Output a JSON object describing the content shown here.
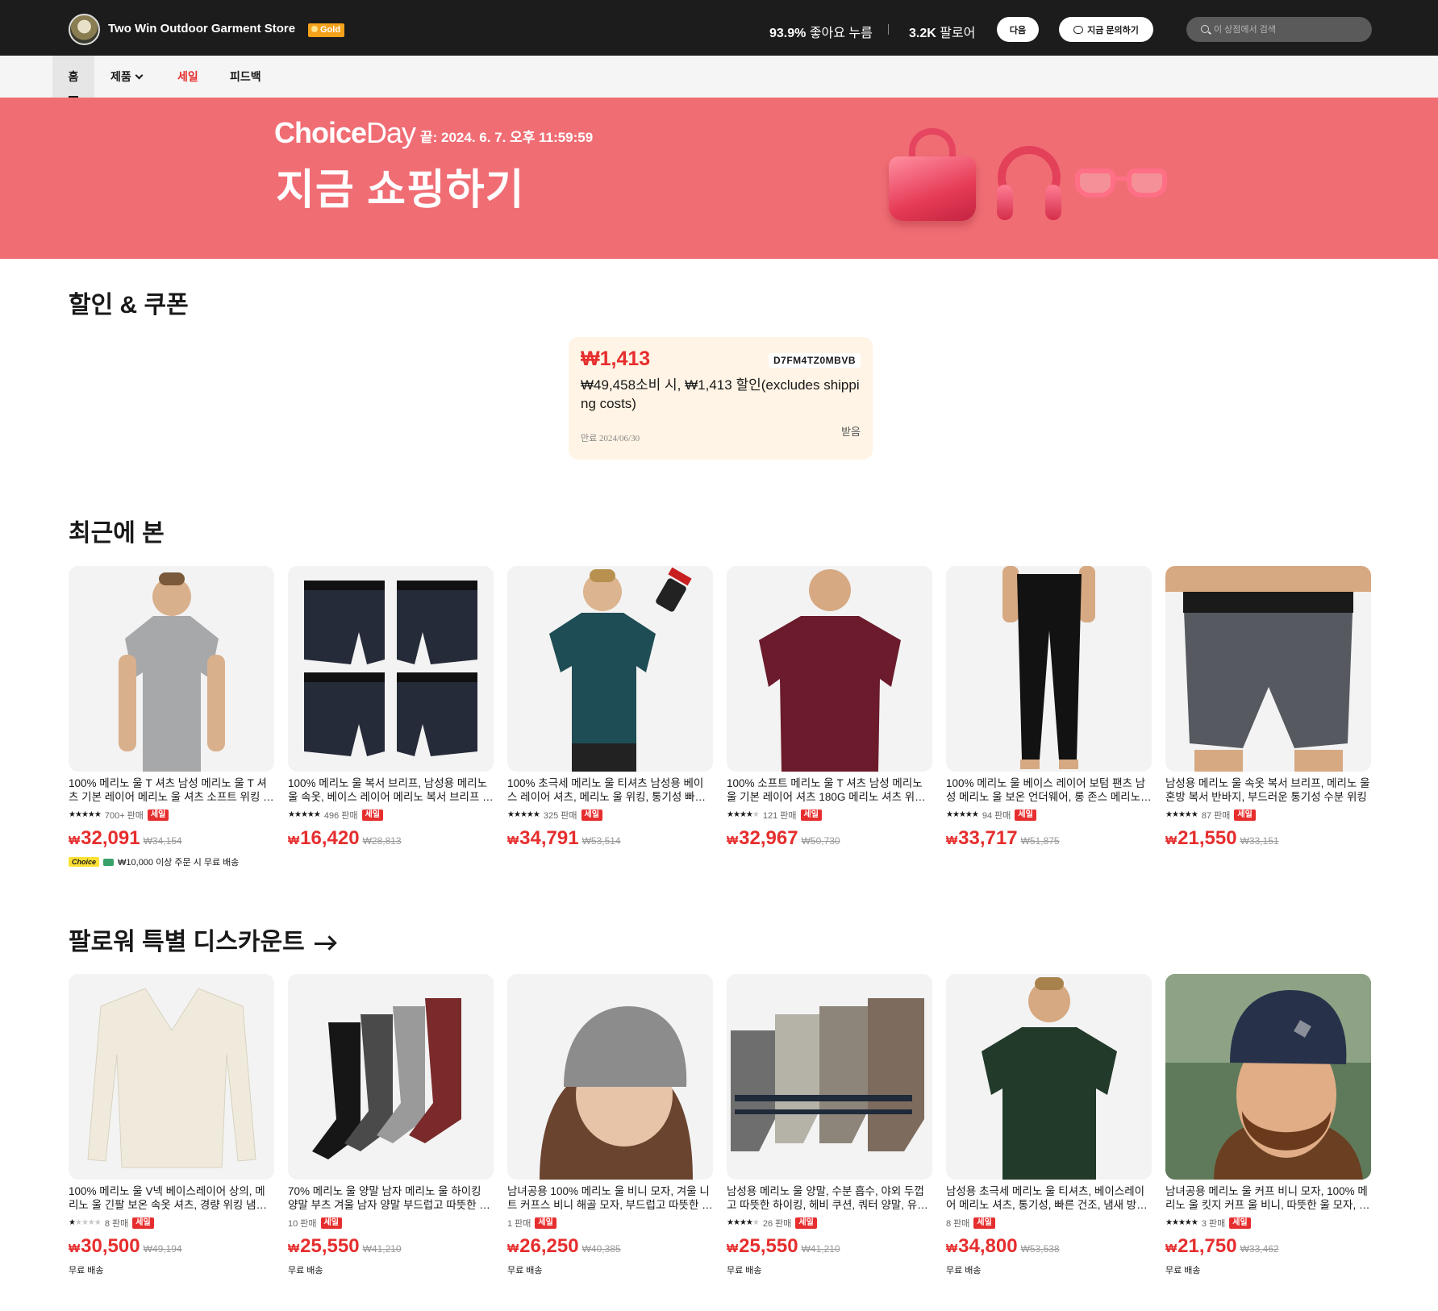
{
  "header": {
    "store_name": "Two Win Outdoor Garment Store",
    "badge": "Gold",
    "likes_value": "93.9%",
    "likes_label": " 좋아요 누름",
    "followers_value": "3.2K",
    "followers_label": " 팔로어",
    "follow_button": "다음",
    "inquire_button": "지금 문의하기",
    "search_placeholder": "이 상점에서 검색"
  },
  "nav": {
    "home": "홈",
    "products": "제품",
    "sale": "세일",
    "feedback": "피드백"
  },
  "banner": {
    "logo_choice": "Choice",
    "logo_day": "Day",
    "end_text": "끝: 2024. 6. 7. 오후 11:59:59",
    "cta": "지금 쇼핑하기"
  },
  "coupons": {
    "title": "할인 & 쿠폰",
    "amount": "₩1,413",
    "code": "D7FM4TZ0MBVB",
    "description": "₩49,458소비 시, ₩1,413 할인(excludes shipping costs)",
    "expiry": "만료 2024/06/30",
    "claim": "받음"
  },
  "recent": {
    "title": "최근에 본",
    "items": [
      {
        "title": "100% 메리노 울 T 셔츠 남성 메리노 울 T 셔츠 기본 레이어 메리노 울 셔츠 소프트 위킹 통기성",
        "stars": 4.5,
        "sold": "700+ 판매",
        "sale": "세일",
        "currency": "₩",
        "price": "32,091",
        "original": "₩34,154",
        "choice": "Choice",
        "shipping": "₩10,000 이상 주문 시 무료 배송"
      },
      {
        "title": "100% 메리노 울 복서 브리프, 남성용 메리노 울 속옷, 베이스 레이어 메리노 복서 브리프 팬츠",
        "stars": 5,
        "sold": "496 판매",
        "sale": "세일",
        "currency": "₩",
        "price": "16,420",
        "original": "₩28,813"
      },
      {
        "title": "100% 초극세 메리노 울 티셔츠 남성용 베이스 레이어 셔츠, 메리노 울 위킹, 통기성 빠른 건조",
        "stars": 4.5,
        "sold": "325 판매",
        "sale": "세일",
        "currency": "₩",
        "price": "34,791",
        "original": "₩53,514"
      },
      {
        "title": "100% 소프트 메리노 울 T 셔츠 남성 메리노 울 기본 레이어 셔츠 180G 메리노 셔츠 위킹 통기성",
        "stars": 4,
        "sold": "121 판매",
        "sale": "세일",
        "currency": "₩",
        "price": "32,967",
        "original": "₩50,730"
      },
      {
        "title": "100% 메리노 울 베이스 레이어 보텀 팬츠 남성 메리노 울 보온 언더웨어, 롱 존스 메리노 레깅스",
        "stars": 4.5,
        "sold": "94 판매",
        "sale": "세일",
        "currency": "₩",
        "price": "33,717",
        "original": "₩51,875"
      },
      {
        "title": "남성용 메리노 울 속옷 복서 브리프, 메리노 울 혼방 복서 반바지, 부드러운 통기성 수분 위킹",
        "stars": 4.5,
        "sold": "87 판매",
        "sale": "세일",
        "currency": "₩",
        "price": "21,550",
        "original": "₩33,151"
      }
    ]
  },
  "follower": {
    "title": "팔로워 특별 디스카운트",
    "items": [
      {
        "title": "100% 메리노 울 V넥 베이스레이어 상의, 메리노 울 긴팔 보온 속옷 셔츠, 경량 위킹 냄새 방지",
        "stars": 1,
        "sold": "8 판매",
        "sale": "세일",
        "currency": "₩",
        "price": "30,500",
        "original": "₩49,194",
        "shipping": "무료 배송"
      },
      {
        "title": "70% 메리노 울 양말 남자 메리노 울 하이킹 양말 부츠 겨울 남자 양말 부드럽고 따뜻한 두꺼운",
        "stars": 0,
        "sold": "10 판매",
        "sale": "세일",
        "currency": "₩",
        "price": "25,550",
        "original": "₩41,210",
        "shipping": "무료 배송"
      },
      {
        "title": "남녀공용 100% 메리노 울 비니 모자, 겨울 니트 커프스 비니 해골 모자, 부드럽고 따뜻한 모자",
        "stars": 0,
        "sold": "1 판매",
        "sale": "세일",
        "currency": "₩",
        "price": "26,250",
        "original": "₩40,385",
        "shipping": "무료 배송"
      },
      {
        "title": "남성용 메리노 울 양말, 수분 흡수, 야외 두껍고 따뜻한 하이킹, 헤비 쿠션, 쿼터 양말, 유로 사이즈",
        "stars": 4,
        "sold": "26 판매",
        "sale": "세일",
        "currency": "₩",
        "price": "25,550",
        "original": "₩41,210",
        "shipping": "무료 배송"
      },
      {
        "title": "남성용 초극세 메리노 울 티셔츠, 베이스레이어 메리노 셔츠, 통기성, 빠른 건조, 냄새 방지, 캐주얼",
        "stars": 0,
        "sold": "8 판매",
        "sale": "세일",
        "currency": "₩",
        "price": "34,800",
        "original": "₩53,538",
        "shipping": "무료 배송"
      },
      {
        "title": "남녀공용 메리노 울 커프 비니 모자, 100% 메리노 울 킷지 커프 울 비니, 따뜻한 울 모자, 겨울",
        "stars": 5,
        "sold": "3 판매",
        "sale": "세일",
        "currency": "₩",
        "price": "21,750",
        "original": "₩33,462",
        "shipping": "무료 배송"
      }
    ]
  },
  "colors": {
    "sale_red": "#e62e2e",
    "banner_pink": "#f06d74",
    "header_dark": "#1c1c1c",
    "coupon_bg": "#fff4e5"
  }
}
